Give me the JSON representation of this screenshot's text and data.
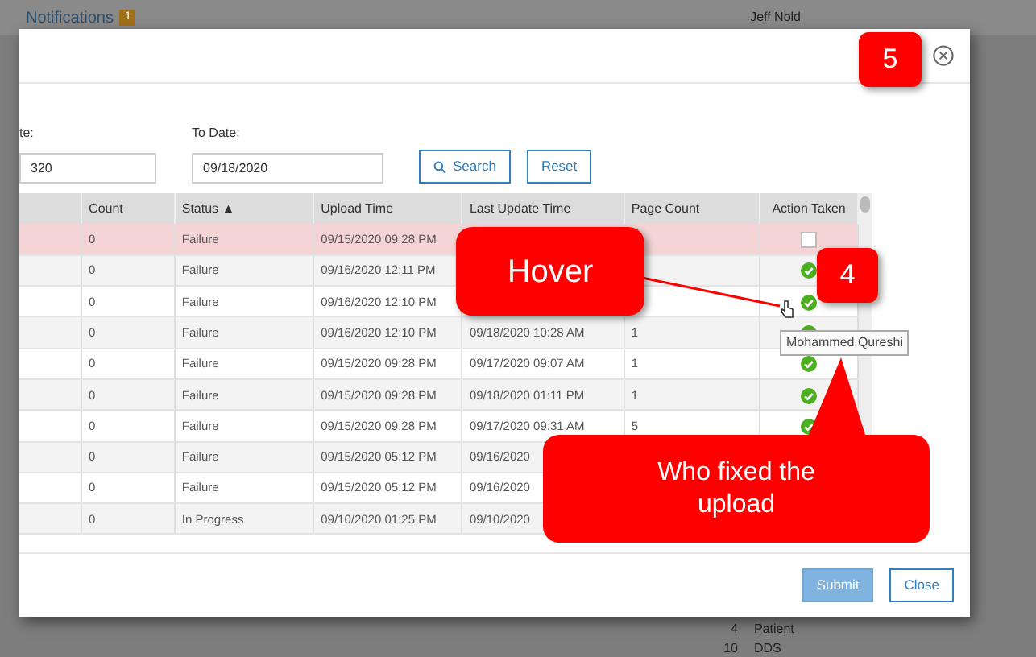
{
  "topbar": {
    "title": "Notifications",
    "badge": "1",
    "user": "Jeff Nold"
  },
  "background_rows": [
    {
      "count": "4",
      "label": "Patient"
    },
    {
      "count": "10",
      "label": "DDS"
    }
  ],
  "filters": {
    "from_label": "te:",
    "from_value": "320",
    "to_label": "To Date:",
    "to_value": "09/18/2020",
    "search_button": "Search",
    "reset_button": "Reset"
  },
  "table": {
    "columns": [
      "",
      "Count",
      "Status ▲",
      "Upload Time",
      "Last Update Time",
      "Page Count",
      "Action Taken"
    ],
    "rows": [
      {
        "selected": true,
        "cells": [
          "",
          "0",
          "Failure",
          "09/15/2020 09:28 PM",
          "",
          ""
        ],
        "action": {
          "kind": "checkbox",
          "checked": false
        }
      },
      {
        "selected": false,
        "cells": [
          "",
          "0",
          "Failure",
          "09/16/2020 12:11 PM",
          "",
          ""
        ],
        "action": {
          "kind": "check"
        }
      },
      {
        "selected": false,
        "cells": [
          "",
          "0",
          "Failure",
          "09/16/2020 12:10 PM",
          "",
          ""
        ],
        "action": {
          "kind": "check"
        }
      },
      {
        "selected": false,
        "cells": [
          "",
          "0",
          "Failure",
          "09/16/2020 12:10 PM",
          "09/18/2020 10:28 AM",
          "1"
        ],
        "action": {
          "kind": "check"
        }
      },
      {
        "selected": false,
        "cells": [
          "",
          "0",
          "Failure",
          "09/15/2020 09:28 PM",
          "09/17/2020 09:07 AM",
          "1"
        ],
        "action": {
          "kind": "check"
        }
      },
      {
        "selected": false,
        "cells": [
          "",
          "0",
          "Failure",
          "09/15/2020 09:28 PM",
          "09/18/2020 01:11 PM",
          "1"
        ],
        "action": {
          "kind": "check"
        }
      },
      {
        "selected": false,
        "cells": [
          "",
          "0",
          "Failure",
          "09/15/2020 09:28 PM",
          "09/17/2020 09:31 AM",
          "5"
        ],
        "action": {
          "kind": "check"
        }
      },
      {
        "selected": false,
        "cells": [
          "",
          "0",
          "Failure",
          "09/15/2020 05:12 PM",
          "09/16/2020",
          ""
        ],
        "action": {
          "kind": "none"
        }
      },
      {
        "selected": false,
        "cells": [
          "",
          "0",
          "Failure",
          "09/15/2020 05:12 PM",
          "09/16/2020",
          ""
        ],
        "action": {
          "kind": "none"
        }
      },
      {
        "selected": false,
        "cells": [
          "",
          "0",
          "In Progress",
          "09/10/2020 01:25 PM",
          "09/10/2020",
          ""
        ],
        "action": {
          "kind": "none"
        }
      }
    ]
  },
  "footer": {
    "submit_button": "Submit",
    "close_button": "Close"
  },
  "annotations": {
    "hover_callout": "Hover",
    "step_4": "4",
    "step_5": "5",
    "tooltip": "Mohammed Qureshi",
    "explain_callout": "Who fixed the upload"
  }
}
